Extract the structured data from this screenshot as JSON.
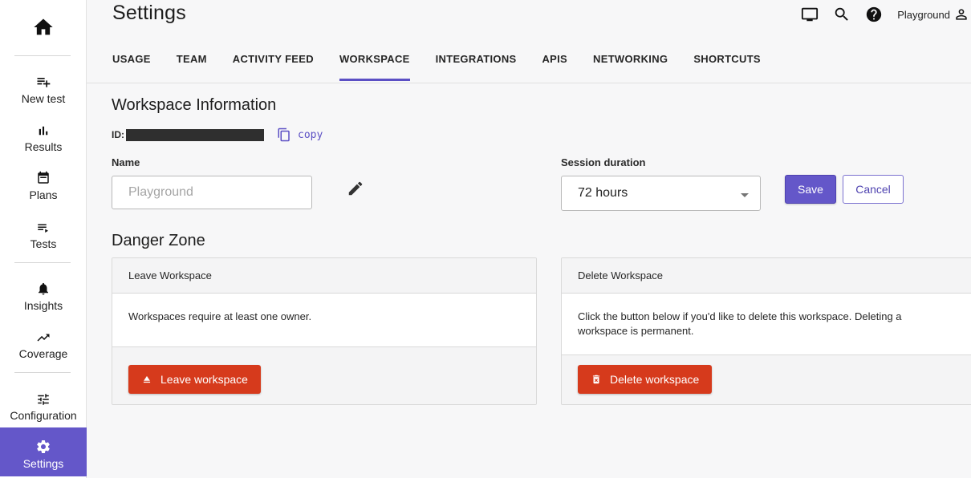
{
  "sidebar": {
    "home_icon": "home-icon",
    "items": [
      {
        "label": "New test",
        "icon": "playlist-add-icon"
      },
      {
        "label": "Results",
        "icon": "bar-chart-icon"
      },
      {
        "label": "Plans",
        "icon": "calendar-icon"
      },
      {
        "label": "Tests",
        "icon": "list-play-icon"
      },
      {
        "label": "Insights",
        "icon": "bell-icon"
      },
      {
        "label": "Coverage",
        "icon": "trending-up-icon"
      },
      {
        "label": "Configuration",
        "icon": "tune-icon"
      },
      {
        "label": "Settings",
        "icon": "gear-icon",
        "active": true
      }
    ]
  },
  "header": {
    "title": "Settings",
    "workspace_name": "Playground"
  },
  "tabs": [
    {
      "label": "USAGE"
    },
    {
      "label": "TEAM"
    },
    {
      "label": "ACTIVITY FEED"
    },
    {
      "label": "WORKSPACE",
      "active": true
    },
    {
      "label": "INTEGRATIONS"
    },
    {
      "label": "APIS"
    },
    {
      "label": "NETWORKING"
    },
    {
      "label": "SHORTCUTS"
    }
  ],
  "workspace_info": {
    "title": "Workspace Information",
    "id_label": "ID:",
    "copy_label": "copy",
    "name_label": "Name",
    "name_placeholder": "Playground",
    "session_label": "Session duration",
    "session_value": "72 hours",
    "save_label": "Save",
    "cancel_label": "Cancel"
  },
  "danger_zone": {
    "title": "Danger Zone",
    "leave": {
      "header": "Leave Workspace",
      "body": "Workspaces require at least one owner.",
      "button": "Leave workspace"
    },
    "delete": {
      "header": "Delete Workspace",
      "body": "Click the button below if you'd like to delete this workspace. Deleting a workspace is permanent.",
      "button": "Delete workspace"
    }
  },
  "colors": {
    "accent": "#6457c9",
    "danger": "#d63a1c"
  }
}
